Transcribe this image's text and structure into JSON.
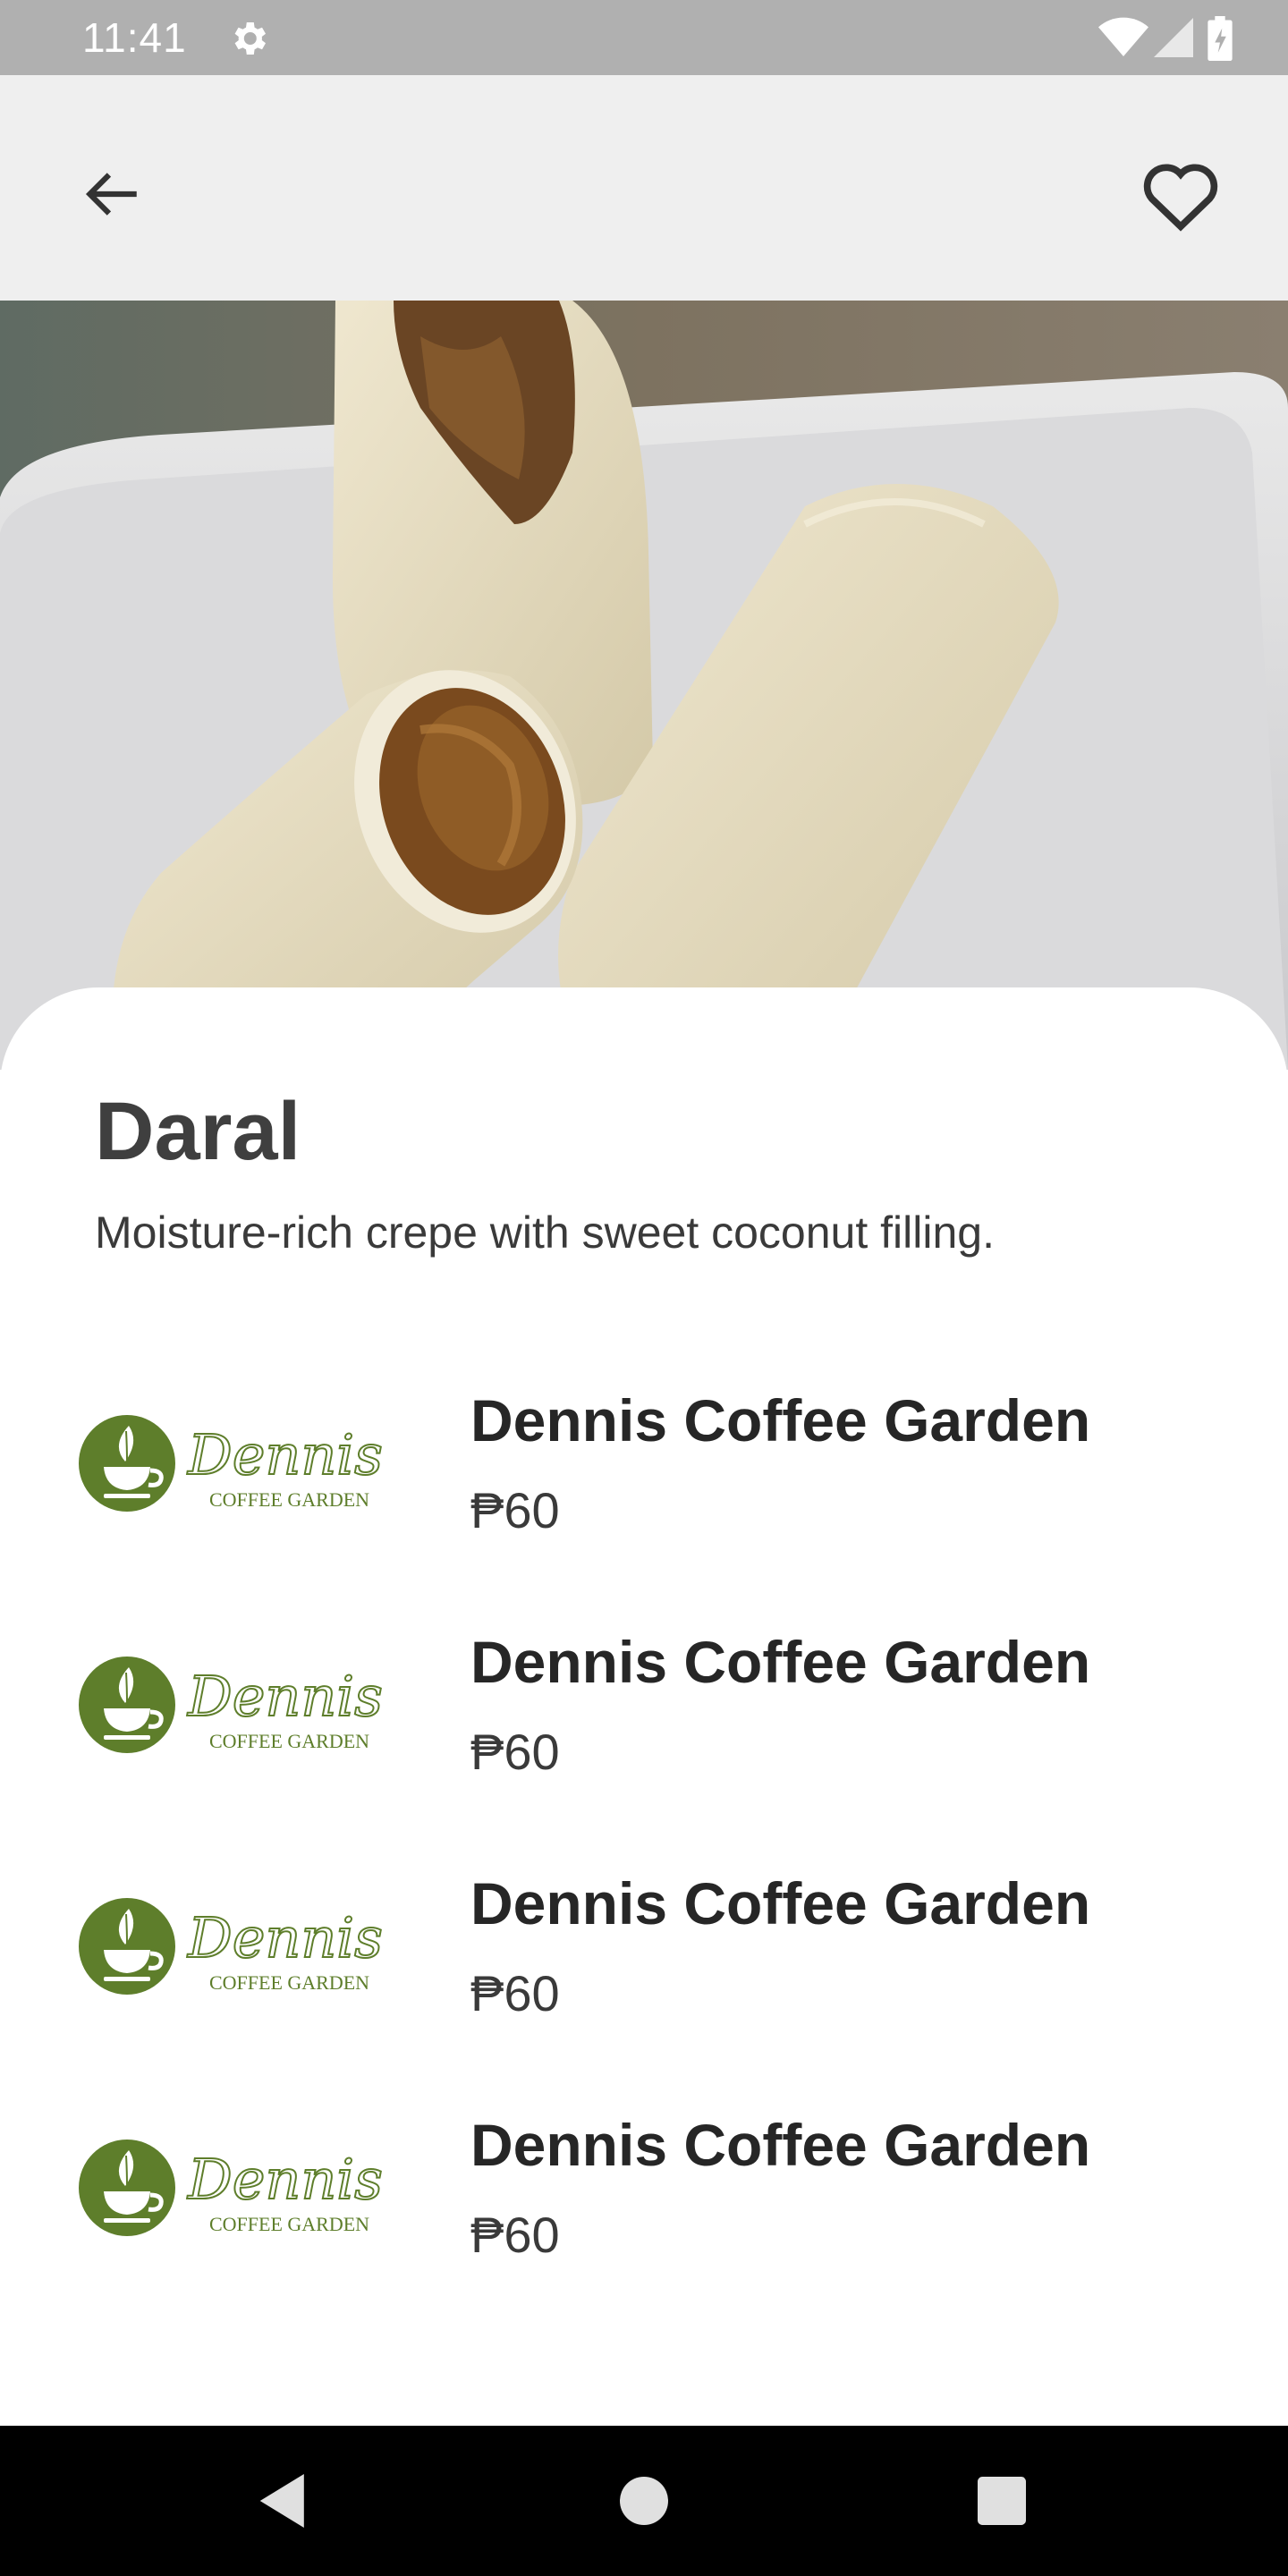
{
  "status_bar": {
    "time": "11:41",
    "icons": [
      "gear-icon",
      "wifi-icon",
      "cell-signal-icon",
      "battery-icon"
    ]
  },
  "app_bar": {
    "back_icon": "arrow-left-icon",
    "favorite_icon": "heart-outline-icon"
  },
  "product": {
    "name": "Daral",
    "description": "Moisture-rich crepe with sweet coconut filling."
  },
  "vendors": [
    {
      "name": "Dennis Coffee Garden",
      "price": "₱60",
      "logo_script": "Dennis",
      "logo_sub": "COFFEE GARDEN"
    },
    {
      "name": "Dennis Coffee Garden",
      "price": "₱60",
      "logo_script": "Dennis",
      "logo_sub": "COFFEE GARDEN"
    },
    {
      "name": "Dennis Coffee Garden",
      "price": "₱60",
      "logo_script": "Dennis",
      "logo_sub": "COFFEE GARDEN"
    },
    {
      "name": "Dennis Coffee Garden",
      "price": "₱60",
      "logo_script": "Dennis",
      "logo_sub": "COFFEE GARDEN"
    }
  ],
  "nav_bar": {
    "buttons": [
      "back-triangle-icon",
      "home-circle-icon",
      "recents-square-icon"
    ]
  },
  "colors": {
    "status_bar": "#b0b0b0",
    "app_bar": "#efefef",
    "brand_green": "#5e7e2b",
    "title": "#3f3f3f",
    "nav_bar": "#000000"
  }
}
